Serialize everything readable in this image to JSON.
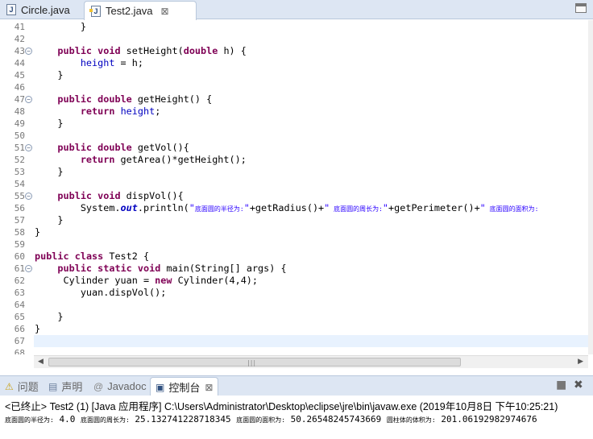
{
  "editor_tabs": [
    {
      "name": "Circle.java",
      "active": false
    },
    {
      "name": "Test2.java",
      "active": true,
      "close": "⊠"
    }
  ],
  "code_lines": [
    {
      "num": "41",
      "fold": false,
      "segs": [
        [
          "p",
          "        }"
        ]
      ]
    },
    {
      "num": "42",
      "fold": false,
      "segs": []
    },
    {
      "num": "43",
      "fold": true,
      "segs": [
        [
          "p",
          "    "
        ],
        [
          "kw",
          "public"
        ],
        [
          "p",
          " "
        ],
        [
          "kw",
          "void"
        ],
        [
          "p",
          " setHeight("
        ],
        [
          "kw",
          "double"
        ],
        [
          "p",
          " h) {"
        ]
      ]
    },
    {
      "num": "44",
      "fold": false,
      "segs": [
        [
          "p",
          "        "
        ],
        [
          "fld",
          "height"
        ],
        [
          "p",
          " = h;"
        ]
      ]
    },
    {
      "num": "45",
      "fold": false,
      "segs": [
        [
          "p",
          "    }"
        ]
      ]
    },
    {
      "num": "46",
      "fold": false,
      "segs": []
    },
    {
      "num": "47",
      "fold": true,
      "segs": [
        [
          "p",
          "    "
        ],
        [
          "kw",
          "public"
        ],
        [
          "p",
          " "
        ],
        [
          "kw",
          "double"
        ],
        [
          "p",
          " getHeight() {"
        ]
      ]
    },
    {
      "num": "48",
      "fold": false,
      "segs": [
        [
          "p",
          "        "
        ],
        [
          "kw",
          "return"
        ],
        [
          "p",
          " "
        ],
        [
          "fld",
          "height"
        ],
        [
          "p",
          ";"
        ]
      ]
    },
    {
      "num": "49",
      "fold": false,
      "segs": [
        [
          "p",
          "    }"
        ]
      ]
    },
    {
      "num": "50",
      "fold": false,
      "segs": []
    },
    {
      "num": "51",
      "fold": true,
      "segs": [
        [
          "p",
          "    "
        ],
        [
          "kw",
          "public"
        ],
        [
          "p",
          " "
        ],
        [
          "kw",
          "double"
        ],
        [
          "p",
          " getVol(){"
        ]
      ]
    },
    {
      "num": "52",
      "fold": false,
      "segs": [
        [
          "p",
          "        "
        ],
        [
          "kw",
          "return"
        ],
        [
          "p",
          " getArea()*getHeight();"
        ]
      ]
    },
    {
      "num": "53",
      "fold": false,
      "segs": [
        [
          "p",
          "    }"
        ]
      ]
    },
    {
      "num": "54",
      "fold": false,
      "segs": []
    },
    {
      "num": "55",
      "fold": true,
      "segs": [
        [
          "p",
          "    "
        ],
        [
          "kw",
          "public"
        ],
        [
          "p",
          " "
        ],
        [
          "kw",
          "void"
        ],
        [
          "p",
          " dispVol(){"
        ]
      ]
    },
    {
      "num": "56",
      "fold": false,
      "segs": [
        [
          "p",
          "        System."
        ],
        [
          "sfld",
          "out"
        ],
        [
          "p",
          ".println("
        ],
        [
          "str",
          "\""
        ],
        [
          "strcjk",
          "底面圆的半径为:"
        ],
        [
          "str",
          "\""
        ],
        [
          "p",
          "+getRadius()+"
        ],
        [
          "str",
          "\""
        ],
        [
          "strcjk",
          " 底面圆的周长为:"
        ],
        [
          "str",
          "\""
        ],
        [
          "p",
          "+getPerimeter()+"
        ],
        [
          "str",
          "\""
        ],
        [
          "strcjk",
          " 底面圆的面积为:"
        ]
      ]
    },
    {
      "num": "57",
      "fold": false,
      "segs": [
        [
          "p",
          "    }"
        ]
      ]
    },
    {
      "num": "58",
      "fold": false,
      "segs": [
        [
          "p",
          "}"
        ]
      ]
    },
    {
      "num": "59",
      "fold": false,
      "segs": []
    },
    {
      "num": "60",
      "fold": false,
      "segs": [
        [
          "kw",
          "public"
        ],
        [
          "p",
          " "
        ],
        [
          "kw",
          "class"
        ],
        [
          "p",
          " Test2 {"
        ]
      ]
    },
    {
      "num": "61",
      "fold": true,
      "segs": [
        [
          "p",
          "    "
        ],
        [
          "kw",
          "public"
        ],
        [
          "p",
          " "
        ],
        [
          "kw",
          "static"
        ],
        [
          "p",
          " "
        ],
        [
          "kw",
          "void"
        ],
        [
          "p",
          " main(String[] args) {"
        ]
      ]
    },
    {
      "num": "62",
      "fold": false,
      "segs": [
        [
          "p",
          "     Cylinder yuan = "
        ],
        [
          "kw",
          "new"
        ],
        [
          "p",
          " Cylinder(4,4);"
        ]
      ]
    },
    {
      "num": "63",
      "fold": false,
      "segs": [
        [
          "p",
          "        yuan.dispVol();"
        ]
      ]
    },
    {
      "num": "64",
      "fold": false,
      "segs": []
    },
    {
      "num": "65",
      "fold": false,
      "segs": [
        [
          "p",
          "    }"
        ]
      ]
    },
    {
      "num": "66",
      "fold": false,
      "segs": [
        [
          "p",
          "}"
        ]
      ]
    },
    {
      "num": "67",
      "fold": false,
      "current": true,
      "segs": []
    },
    {
      "num": "68",
      "fold": false,
      "segs": []
    }
  ],
  "hscroll": {
    "left_arrow": "◀",
    "right_arrow": "▶",
    "grip": "|||"
  },
  "view_tabs": [
    {
      "icon": "⚠",
      "label": "问题"
    },
    {
      "icon": "@",
      "label": "声明",
      "icon_alt": "📄"
    },
    {
      "icon": "@",
      "label": "Javadoc"
    }
  ],
  "console_tab": {
    "icon": "▣",
    "label": "控制台",
    "close": "⊠"
  },
  "view_controls": {
    "terminate": "■",
    "remove": "✖"
  },
  "console": {
    "status": "<已终止> Test2 (1) [Java 应用程序] C:\\Users\\Administrator\\Desktop\\eclipse\\jre\\bin\\javaw.exe (2019年10月8日 下午10:25:21)",
    "output": [
      [
        "cjk",
        "底面圆的半径为:"
      ],
      [
        "p",
        " 4.0 "
      ],
      [
        "cjk",
        "底面圆的周长为:"
      ],
      [
        "p",
        " 25.132741228718345 "
      ],
      [
        "cjk",
        "底面圆的面积为:"
      ],
      [
        "p",
        " 50.26548245743669 "
      ],
      [
        "cjk",
        "圆柱体的体积为:"
      ],
      [
        "p",
        " 201.06192982974676"
      ]
    ]
  },
  "colors": {
    "keyword": "#7f0055",
    "field": "#0000c0",
    "string": "#2a00ff",
    "current_line": "#e8f2fe"
  }
}
